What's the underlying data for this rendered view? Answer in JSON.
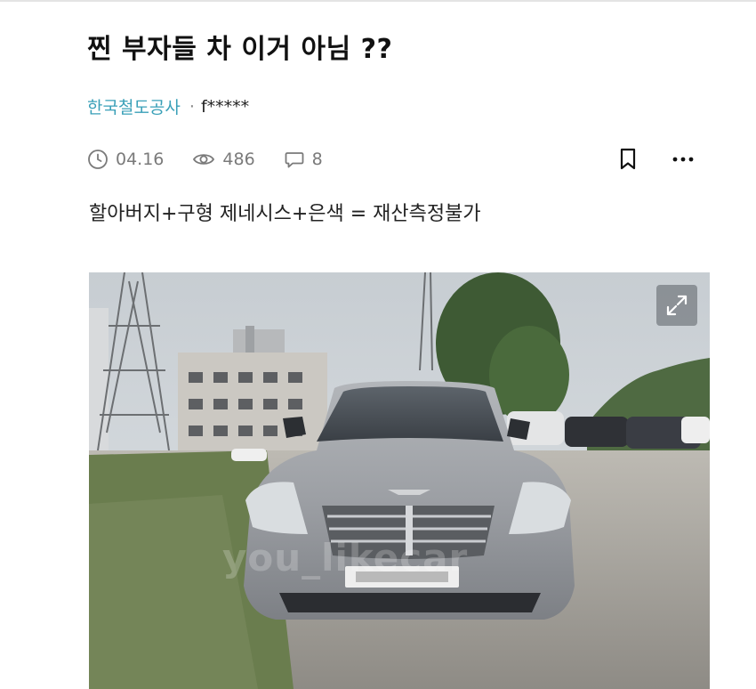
{
  "post": {
    "title": "찐 부자들 차 이거 아님 ??",
    "board": "한국철도공사",
    "separator": "·",
    "author": "f*****",
    "date": "04.16",
    "views": "486",
    "comments": "8",
    "body": "할아버지+구형 제네시스+은색 = 재산측정불가"
  },
  "photo": {
    "watermark": "you_likecar"
  },
  "icons": {
    "date": "clock-icon",
    "views": "eye-icon",
    "comments": "comment-icon",
    "bookmark": "bookmark-icon",
    "more": "more-icon",
    "expand": "expand-icon"
  },
  "colors": {
    "board_link": "#3aa0b8",
    "meta_gray": "#7a7a7a",
    "title": "#111111"
  }
}
